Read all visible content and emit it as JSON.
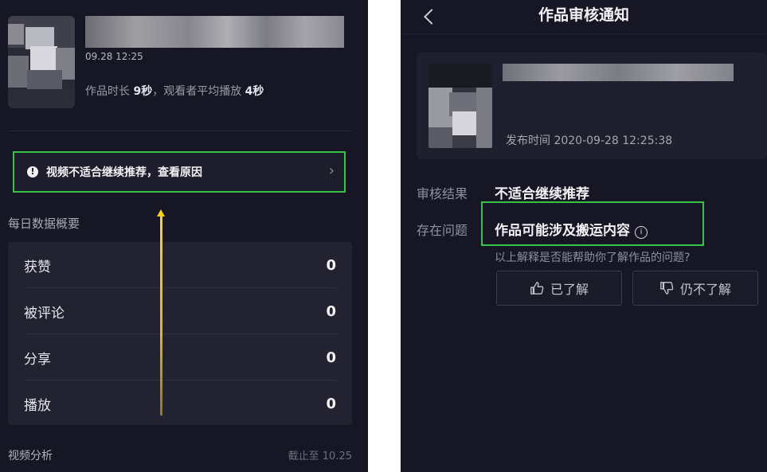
{
  "left": {
    "video": {
      "time": "09.28 12:25",
      "duration_prefix": "作品时长",
      "duration_value": "9秒",
      "avg_prefix": "，观看者平均播放",
      "avg_value": "4秒"
    },
    "notice": {
      "icon": "warning-circle-icon",
      "text": "视频不适合继续推荐，查看原因",
      "chevron": "›"
    },
    "daily_title": "每日数据概要",
    "stats": [
      {
        "label": "获赞",
        "value": "0"
      },
      {
        "label": "被评论",
        "value": "0"
      },
      {
        "label": "分享",
        "value": "0"
      },
      {
        "label": "播放",
        "value": "0"
      }
    ],
    "footer": {
      "title": "视频分析",
      "as_of": "截止至 10.25"
    },
    "accent_color": "#37c246",
    "arrow_color": "#ffd21a"
  },
  "right": {
    "title": "作品审核通知",
    "publish_time": "发布时间 2020-09-28 12:25:38",
    "result_label": "审核结果",
    "result_value": "不适合继续推荐",
    "issue_label": "存在问题",
    "issue_value": "作品可能涉及搬运内容",
    "issue_info_icon": "i",
    "help_question": "以上解释是否能帮助你了解作品的问题?",
    "btn_understood": "已了解",
    "btn_not_understood": "仍不了解"
  }
}
